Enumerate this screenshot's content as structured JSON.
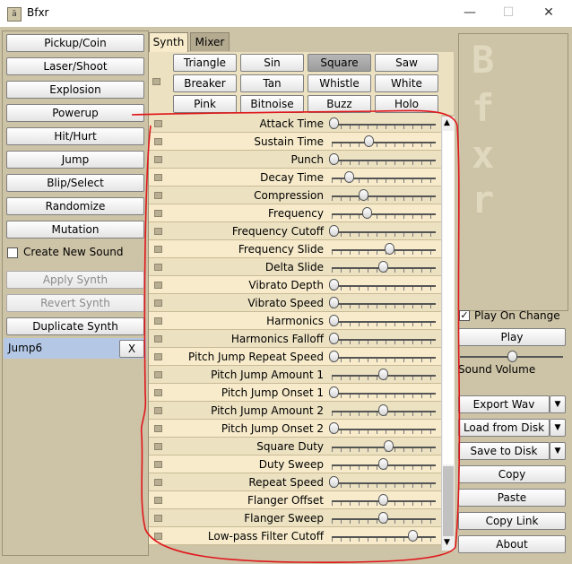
{
  "window": {
    "title": "Bfxr",
    "app_icon": "ā",
    "minimize": "—",
    "maximize": "☐",
    "close": "✕"
  },
  "sidebar": {
    "generators": [
      "Pickup/Coin",
      "Laser/Shoot",
      "Explosion",
      "Powerup",
      "Hit/Hurt",
      "Jump",
      "Blip/Select",
      "Randomize",
      "Mutation"
    ],
    "create_new_sound": {
      "label": "Create New Sound",
      "checked": false
    },
    "apply_synth": "Apply Synth",
    "revert_synth": "Revert Synth",
    "duplicate_synth": "Duplicate Synth",
    "saved_sounds": [
      {
        "name": "Jump6",
        "remove": "X"
      }
    ]
  },
  "tabs": [
    {
      "label": "Synth",
      "active": true
    },
    {
      "label": "Mixer",
      "active": false
    }
  ],
  "waveforms": {
    "selected": "Square",
    "buttons": [
      "Triangle",
      "Sin",
      "Square",
      "Saw",
      "Breaker",
      "Tan",
      "Whistle",
      "White",
      "Pink",
      "Bitnoise",
      "Buzz",
      "Holo"
    ]
  },
  "parameters": [
    {
      "name": "Attack Time",
      "value": 0.0
    },
    {
      "name": "Sustain Time",
      "value": 0.35
    },
    {
      "name": "Punch",
      "value": 0.0
    },
    {
      "name": "Decay Time",
      "value": 0.15
    },
    {
      "name": "Compression",
      "value": 0.3
    },
    {
      "name": "Frequency",
      "value": 0.34
    },
    {
      "name": "Frequency Cutoff",
      "value": 0.0
    },
    {
      "name": "Frequency Slide",
      "value": 0.56
    },
    {
      "name": "Delta Slide",
      "value": 0.5
    },
    {
      "name": "Vibrato Depth",
      "value": 0.0
    },
    {
      "name": "Vibrato Speed",
      "value": 0.0
    },
    {
      "name": "Harmonics",
      "value": 0.0
    },
    {
      "name": "Harmonics Falloff",
      "value": 0.0
    },
    {
      "name": "Pitch Jump Repeat Speed",
      "value": 0.0
    },
    {
      "name": "Pitch Jump Amount 1",
      "value": 0.5
    },
    {
      "name": "Pitch Jump Onset 1",
      "value": 0.0
    },
    {
      "name": "Pitch Jump Amount 2",
      "value": 0.5
    },
    {
      "name": "Pitch Jump Onset 2",
      "value": 0.0
    },
    {
      "name": "Square Duty",
      "value": 0.55
    },
    {
      "name": "Duty Sweep",
      "value": 0.5
    },
    {
      "name": "Repeat Speed",
      "value": 0.0
    },
    {
      "name": "Flanger Offset",
      "value": 0.5
    },
    {
      "name": "Flanger Sweep",
      "value": 0.5
    },
    {
      "name": "Low-pass Filter Cutoff",
      "value": 0.8
    }
  ],
  "right_panel": {
    "logo_text": "Bfxr",
    "play_on_change": {
      "label": "Play On Change",
      "checked": true
    },
    "play": "Play",
    "sound_volume": {
      "label": "Sound Volume",
      "value": 0.5
    },
    "export_wav": "Export Wav",
    "load_from_disk": "Load from Disk",
    "save_to_disk": "Save to Disk",
    "copy": "Copy",
    "paste": "Paste",
    "copy_link": "Copy Link",
    "about": "About"
  },
  "colors": {
    "background": "#cdc3a6",
    "row_even": "#ece1c1",
    "row_odd": "#f7ebcb",
    "annotation_red": "#e0171b",
    "selection_blue": "#b4c8e6"
  }
}
